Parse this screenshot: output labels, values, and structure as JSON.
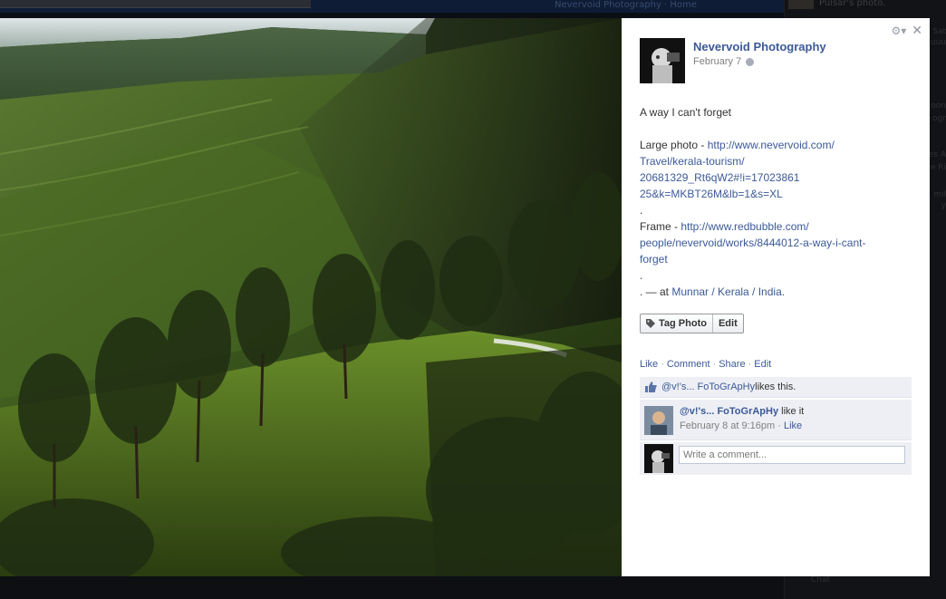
{
  "background": {
    "right_fragment": "Pulsar's photo.",
    "nav_fragment": "Nevervoid Photography · Home",
    "side_fragments": [
      "Sat",
      "uuu",
      "oon",
      "ogr",
      "es A",
      "e Ri",
      "mil",
      "y"
    ],
    "bottom_fragment": "Chat"
  },
  "lightbox": {
    "author": {
      "name": "Nevervoid Photography",
      "date": "February 7"
    },
    "caption": {
      "title": "A way I can't forget",
      "large_label": "Large photo - ",
      "large_link_1": "http://www.nevervoid.com/",
      "large_link_2": "Travel/kerala-tourism/",
      "large_link_3": "20681329_Rt6qW2#!i=17023861",
      "large_link_4": "25&k=MKBT26M&lb=1&s=XL",
      "dot1": ".",
      "frame_label": "Frame - ",
      "frame_link_1": "http://www.redbubble.com/",
      "frame_link_2": "people/nevervoid/works/8444012-a-way-i-cant-",
      "frame_link_3": "forget",
      "dot2": ".",
      "location_prefix": ". — at ",
      "location": "Munnar / Kerala / India."
    },
    "buttons": {
      "tag_photo": "Tag Photo",
      "edit": "Edit"
    },
    "actions": {
      "like": "Like",
      "comment": "Comment",
      "share": "Share",
      "edit": "Edit",
      "separator": "·"
    },
    "likes": {
      "name": "@v!'s... FoToGrApHy",
      "suffix": " likes this."
    },
    "comment": {
      "author": "@v!'s... FoToGrApHy",
      "text": " like it",
      "time": "February 8 at 9:16pm",
      "separator": " · ",
      "like": "Like"
    },
    "write_comment": {
      "placeholder": "Write a comment..."
    }
  },
  "colors": {
    "link": "#3b5998",
    "ufi_bg": "#edeff4",
    "overlay": "#0b0e14"
  }
}
